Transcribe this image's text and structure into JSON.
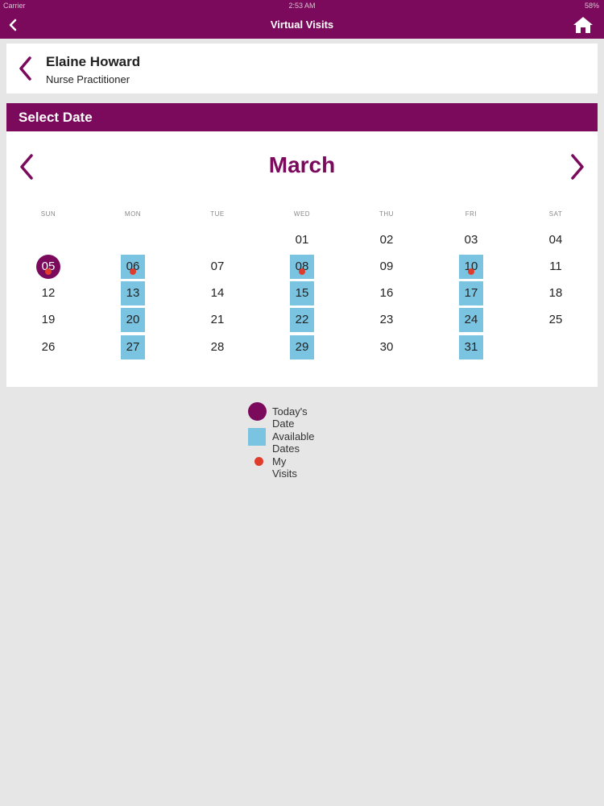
{
  "status_bar": {
    "carrier": "Carrier",
    "time": "2:53 AM",
    "battery": "58%"
  },
  "nav": {
    "title": "Virtual Visits"
  },
  "provider": {
    "name": "Elaine Howard",
    "role": "Nurse Practitioner"
  },
  "section": {
    "title": "Select Date"
  },
  "calendar": {
    "month": "March",
    "weekdays": [
      "SUN",
      "MON",
      "TUE",
      "WED",
      "THU",
      "FRI",
      "SAT"
    ],
    "weeks": [
      [
        "",
        "",
        "",
        "01",
        "02",
        "03",
        "04"
      ],
      [
        "05",
        "06",
        "07",
        "08",
        "09",
        "10",
        "11"
      ],
      [
        "12",
        "13",
        "14",
        "15",
        "16",
        "17",
        "18"
      ],
      [
        "19",
        "20",
        "21",
        "22",
        "23",
        "24",
        "25"
      ],
      [
        "26",
        "27",
        "28",
        "29",
        "30",
        "31",
        ""
      ]
    ],
    "today": "05",
    "available_dates": [
      "06",
      "08",
      "10",
      "13",
      "15",
      "17",
      "20",
      "22",
      "24",
      "27",
      "29",
      "31"
    ],
    "my_visits": [
      "05",
      "06",
      "08",
      "10"
    ]
  },
  "legend": {
    "today": "Today's Date",
    "available": "Available Dates",
    "visits": "My Visits"
  },
  "colors": {
    "brand": "#7c0a5c",
    "available": "#7ac4e2",
    "visit": "#e03c2c"
  }
}
